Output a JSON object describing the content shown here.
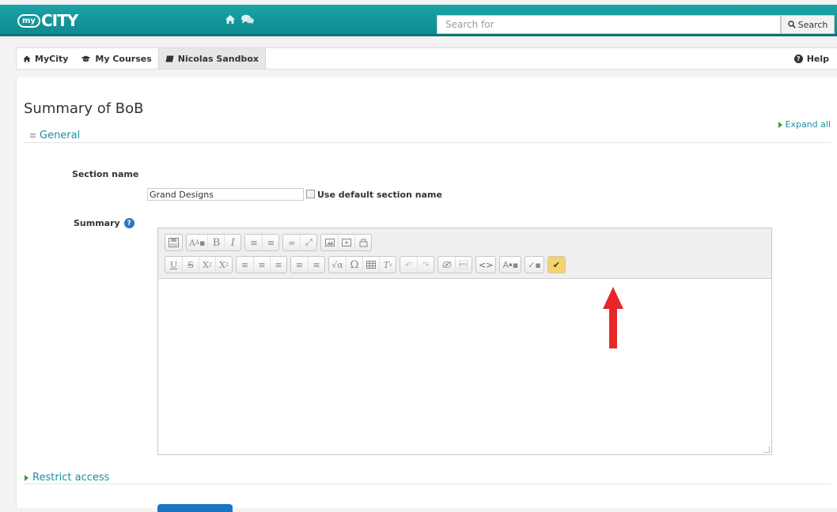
{
  "navbar": {
    "logo_my": "my",
    "logo_city": "CITY",
    "search_placeholder": "Search for",
    "search_button": "Search"
  },
  "subnav": {
    "items": [
      "MyCity",
      "My Courses",
      "Nicolas Sandbox"
    ],
    "help": "Help"
  },
  "page": {
    "title": "Summary of BoB",
    "expand_all": "Expand all",
    "general_legend": "General",
    "section_name_label": "Section name",
    "section_name_value": "Grand Designs",
    "use_default_label": "Use default section name",
    "summary_label": "Summary",
    "restrict_access": "Restrict access"
  },
  "toolbar": {
    "row1": [
      "save-icon",
      "font-style-icon",
      "bold-icon",
      "italic-icon",
      "bullet-list-icon",
      "numbered-list-icon",
      "link-icon",
      "unlink-icon",
      "image-icon",
      "media-icon",
      "manage-files-icon"
    ],
    "row2": [
      "underline-icon",
      "strikethrough-icon",
      "subscript-icon",
      "superscript-icon",
      "align-left-icon",
      "align-center-icon",
      "align-right-icon",
      "outdent-icon",
      "indent-icon",
      "equation-icon",
      "special-char-icon",
      "table-icon",
      "clear-format-icon",
      "undo-icon",
      "redo-icon",
      "accessibility-checker-icon",
      "screenreader-helper-icon",
      "html-icon",
      "font-color-icon",
      "background-color-icon",
      "recording-icon"
    ]
  },
  "colors": {
    "navbar": "#1aa3a8",
    "link": "#1a8fa0",
    "arrow": "#e8262a"
  }
}
